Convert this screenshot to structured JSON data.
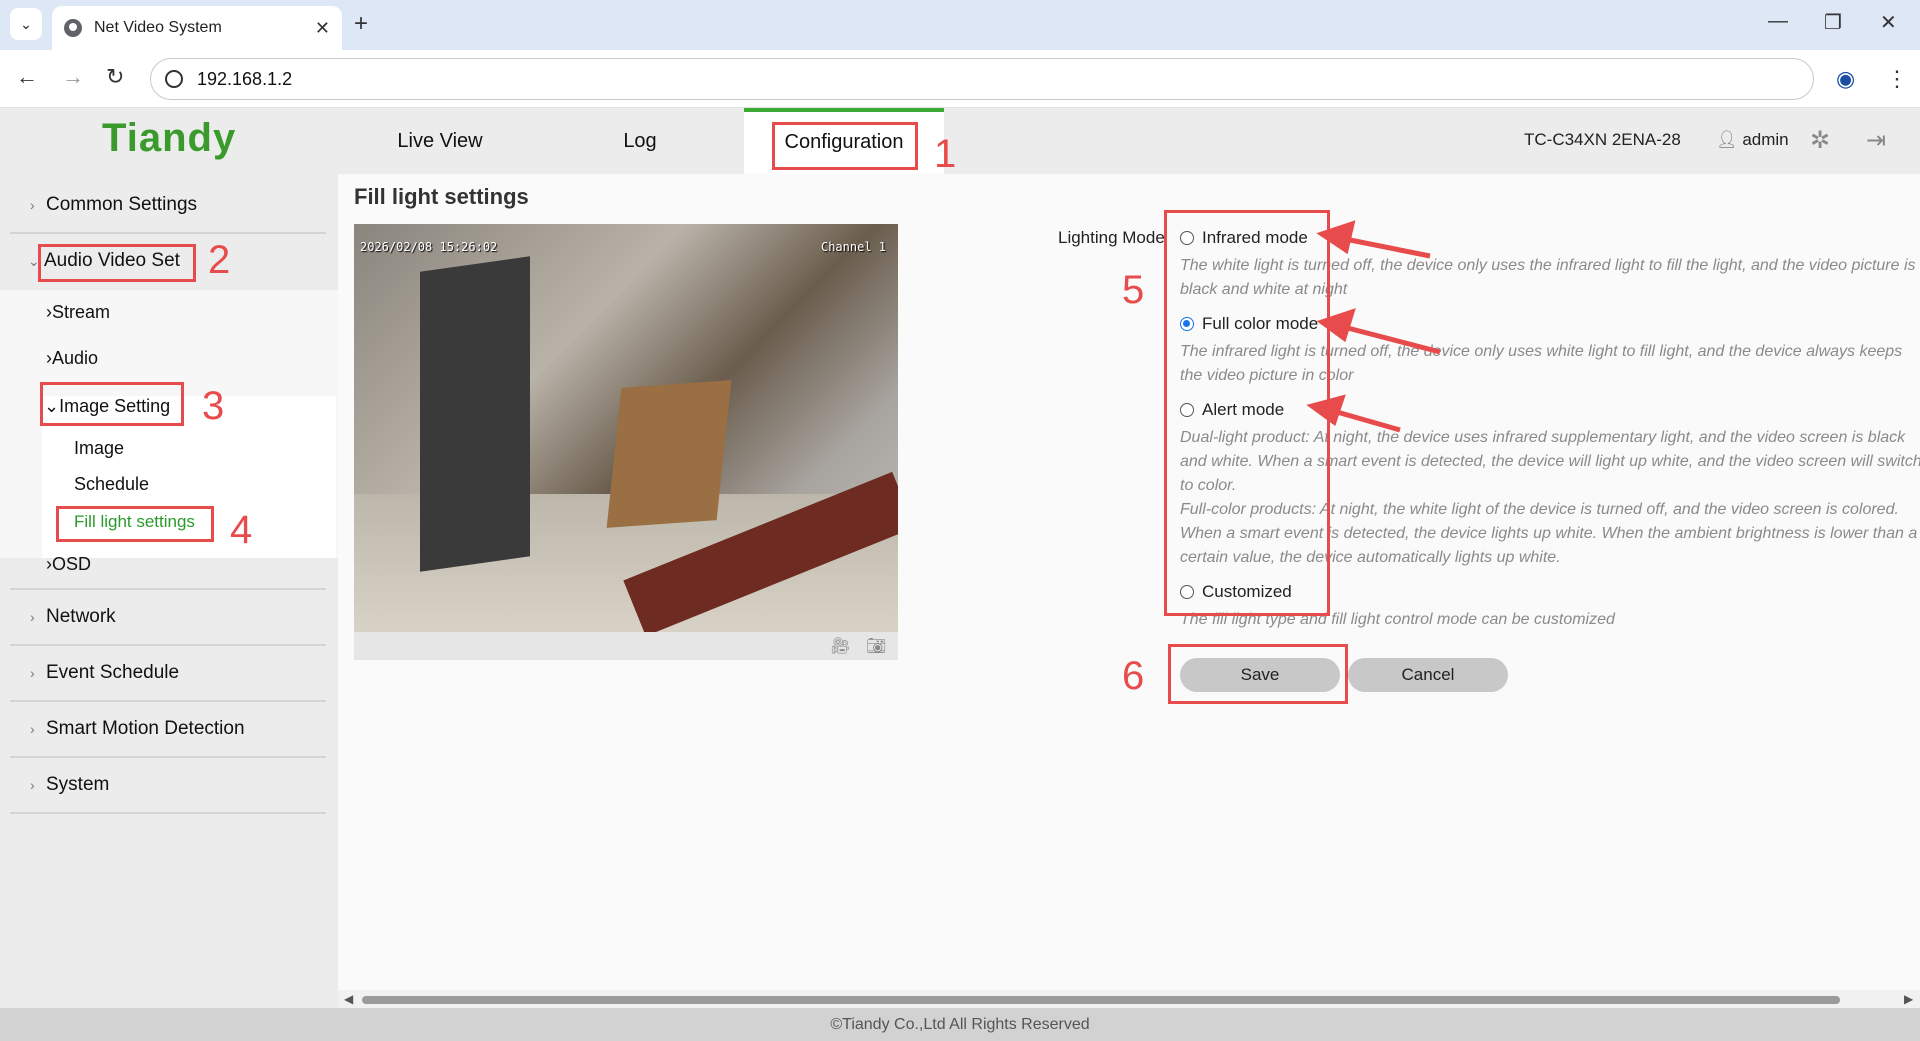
{
  "browser": {
    "tab_title": "Net Video System",
    "tab_close": "✕",
    "new_tab": "+",
    "url": "192.168.1.2",
    "back": "←",
    "forward": "→",
    "reload": "↻",
    "minimize": "—",
    "maximize": "❐",
    "close": "✕",
    "menu": "⋮"
  },
  "header": {
    "logo": "Tiandy",
    "tabs": [
      "Live View",
      "Log",
      "Configuration"
    ],
    "active_tab": "Configuration",
    "device_model": "TC-C34XN 2ENA-28",
    "user": "admin"
  },
  "sidebar": {
    "items": [
      "Common Settings",
      "Audio Video Set",
      "Network",
      "Event Schedule",
      "Smart Motion Detection",
      "System"
    ],
    "audio_video_children": [
      "Stream",
      "Audio",
      "Image Setting",
      "OSD"
    ],
    "image_setting_children": [
      "Image",
      "Schedule",
      "Fill light settings"
    ],
    "active_leaf": "Fill light settings"
  },
  "main": {
    "title": "Fill light settings",
    "video": {
      "timestamp": "2026/02/08 15:26:02",
      "channel": "Channel 1"
    },
    "lighting_mode_label": "Lighting Mode",
    "options": [
      {
        "label": "Infrared mode",
        "selected": false,
        "desc": [
          "The white light is turned off, the device only uses the infrared light to fill the light, and the video picture is",
          "black and white at night"
        ]
      },
      {
        "label": "Full color mode",
        "selected": true,
        "desc": [
          "The infrared light is turned off, the device only uses white light to fill light, and the device always keeps",
          "the video picture in color"
        ]
      },
      {
        "label": "Alert mode",
        "selected": false,
        "desc": [
          "Dual-light product: At night, the device uses infrared supplementary light, and the video screen is black",
          "and white. When a smart event is detected, the device will light up white, and the video screen will switch",
          "to color.",
          "Full-color products: At night, the white light of the device is turned off, and the video screen is colored.",
          "When a smart event is detected, the device lights up white. When the ambient brightness is lower than a",
          "certain value, the device automatically lights up white."
        ]
      },
      {
        "label": "Customized",
        "selected": false,
        "desc": [
          "The fill light type and fill light control mode can be customized"
        ]
      }
    ],
    "save_label": "Save",
    "cancel_label": "Cancel"
  },
  "footer": "©Tiandy Co.,Ltd All Rights Reserved",
  "annotations": {
    "color": "#e84b4b",
    "step_numbers": [
      "1",
      "2",
      "3",
      "4",
      "5",
      "6"
    ]
  }
}
